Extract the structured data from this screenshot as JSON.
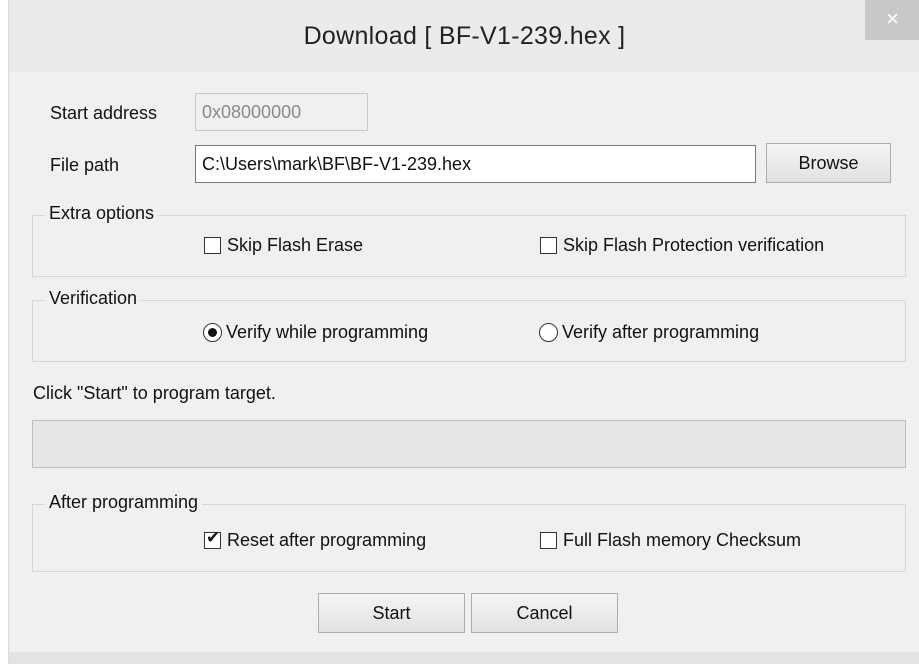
{
  "window": {
    "title": "Download [ BF-V1-239.hex ]",
    "close_glyph": "×"
  },
  "start_address": {
    "label": "Start address",
    "value": "0x08000000"
  },
  "file_path": {
    "label": "File path",
    "value": "C:\\Users\\mark\\BF\\BF-V1-239.hex",
    "browse_label": "Browse"
  },
  "extra_options": {
    "title": "Extra options",
    "skip_flash_erase": {
      "label": "Skip Flash Erase",
      "checked": false
    },
    "skip_flash_protection": {
      "label": "Skip Flash Protection verification",
      "checked": false
    }
  },
  "verification": {
    "title": "Verification",
    "while_programming": {
      "label": "Verify while programming",
      "selected": true
    },
    "after_programming": {
      "label": "Verify after programming",
      "selected": false
    }
  },
  "status": {
    "message": "Click \"Start\" to program target.",
    "progress_percent": 0
  },
  "after_programming": {
    "title": "After programming",
    "reset": {
      "label": "Reset after programming",
      "checked": true
    },
    "checksum": {
      "label": "Full Flash memory Checksum",
      "checked": false
    }
  },
  "actions": {
    "start_label": "Start",
    "cancel_label": "Cancel"
  },
  "icons": {
    "checkmark": "✔"
  },
  "colors": {
    "window_bg": "#ebebeb",
    "content_bg": "#f0f0f0",
    "progress_fill": "#06b025"
  }
}
